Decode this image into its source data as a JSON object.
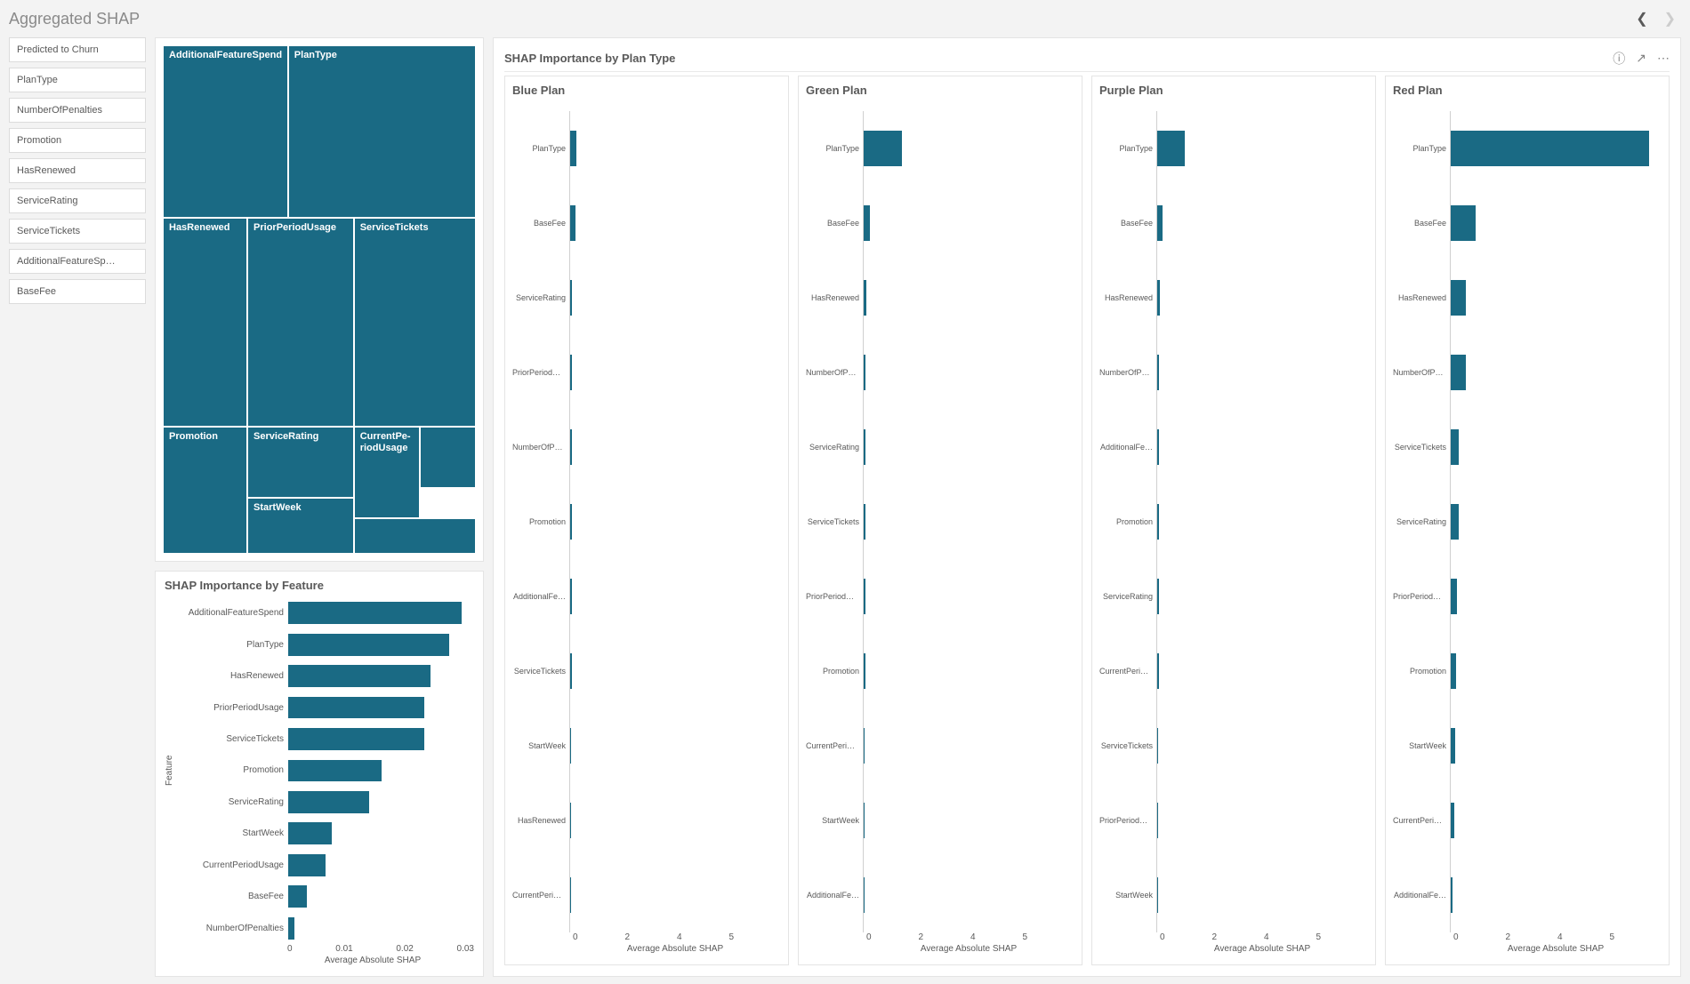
{
  "header": {
    "title": "Aggregated SHAP"
  },
  "filters": [
    "Predicted to Churn",
    "PlanType",
    "NumberOfPenalties",
    "Promotion",
    "HasRenewed",
    "ServiceRating",
    "ServiceTickets",
    "AdditionalFeatureSp…",
    "BaseFee"
  ],
  "treemap": {
    "labels": {
      "AdditionalFeatureSpend": "AdditionalFeatureSpend",
      "PlanType": "PlanType",
      "HasRenewed": "HasRenewed",
      "PriorPeriodUsage": "PriorPeriodUsage",
      "ServiceTickets": "ServiceTickets",
      "Promotion": "Promotion",
      "ServiceRating": "ServiceRating",
      "CurrentPeriodUsage": "CurrentPe-\nriodUsage",
      "StartWeek": "StartWeek"
    }
  },
  "feature_chart": {
    "title": "SHAP Importance by Feature",
    "ylabel": "Feature",
    "xlabel": "Average Absolute SHAP"
  },
  "right_panel": {
    "title": "SHAP Importance by Plan Type",
    "xlabel": "Average Absolute SHAP",
    "plan_titles": [
      "Blue Plan",
      "Green Plan",
      "Purple Plan",
      "Red Plan"
    ]
  },
  "chart_data": {
    "treemap": {
      "type": "treemap",
      "items": [
        {
          "name": "AdditionalFeatureSpend",
          "value": 0.028
        },
        {
          "name": "PlanType",
          "value": 0.026
        },
        {
          "name": "HasRenewed",
          "value": 0.023
        },
        {
          "name": "PriorPeriodUsage",
          "value": 0.022
        },
        {
          "name": "ServiceTickets",
          "value": 0.022
        },
        {
          "name": "Promotion",
          "value": 0.015
        },
        {
          "name": "ServiceRating",
          "value": 0.013
        },
        {
          "name": "StartWeek",
          "value": 0.007
        },
        {
          "name": "CurrentPeriodUsage",
          "value": 0.006
        },
        {
          "name": "BaseFee",
          "value": 0.003
        },
        {
          "name": "NumberOfPenalties",
          "value": 0.001
        }
      ]
    },
    "feature_bar": {
      "type": "bar",
      "orientation": "horizontal",
      "xlabel": "Average Absolute SHAP",
      "ylabel": "Feature",
      "xlim": [
        0,
        0.03
      ],
      "ticks": [
        0,
        0.01,
        0.02,
        0.03
      ],
      "categories": [
        "AdditionalFeatureSpend",
        "PlanType",
        "HasRenewed",
        "PriorPeriodUsage",
        "ServiceTickets",
        "Promotion",
        "ServiceRating",
        "StartWeek",
        "CurrentPeriodUsage",
        "BaseFee",
        "NumberOfPenalties"
      ],
      "values": [
        0.028,
        0.026,
        0.023,
        0.022,
        0.022,
        0.015,
        0.013,
        0.007,
        0.006,
        0.003,
        0.001
      ]
    },
    "plan_bars": {
      "type": "bar",
      "orientation": "horizontal",
      "xlabel": "Average Absolute SHAP",
      "xlim": [
        0,
        5
      ],
      "ticks": [
        0,
        2,
        4,
        5
      ],
      "series": [
        {
          "name": "Blue Plan",
          "categories": [
            "PlanType",
            "BaseFee",
            "ServiceRating",
            "PriorPeriodU…",
            "NumberOfPe…",
            "Promotion",
            "AdditionalFe…",
            "ServiceTickets",
            "StartWeek",
            "HasRenewed",
            "CurrentPerio…"
          ],
          "values": [
            0.15,
            0.12,
            0.05,
            0.05,
            0.05,
            0.04,
            0.04,
            0.04,
            0.03,
            0.03,
            0.02
          ]
        },
        {
          "name": "Green Plan",
          "categories": [
            "PlanType",
            "BaseFee",
            "HasRenewed",
            "NumberOfPe…",
            "ServiceRating",
            "ServiceTickets",
            "PriorPeriodU…",
            "Promotion",
            "CurrentPerio…",
            "StartWeek",
            "AdditionalFe…"
          ],
          "values": [
            0.9,
            0.15,
            0.06,
            0.05,
            0.05,
            0.04,
            0.04,
            0.04,
            0.03,
            0.03,
            0.02
          ]
        },
        {
          "name": "Purple Plan",
          "categories": [
            "PlanType",
            "BaseFee",
            "HasRenewed",
            "NumberOfPe…",
            "AdditionalFe…",
            "Promotion",
            "ServiceRating",
            "CurrentPerio…",
            "ServiceTickets",
            "PriorPeriodU…",
            "StartWeek"
          ],
          "values": [
            0.65,
            0.12,
            0.06,
            0.05,
            0.05,
            0.04,
            0.04,
            0.04,
            0.03,
            0.03,
            0.02
          ]
        },
        {
          "name": "Red Plan",
          "categories": [
            "PlanType",
            "BaseFee",
            "HasRenewed",
            "NumberOfPe…",
            "ServiceTickets",
            "ServiceRating",
            "PriorPeriodU…",
            "Promotion",
            "StartWeek",
            "CurrentPerio…",
            "AdditionalFe…"
          ],
          "values": [
            4.7,
            0.6,
            0.35,
            0.35,
            0.2,
            0.18,
            0.15,
            0.12,
            0.1,
            0.08,
            0.05
          ]
        }
      ]
    }
  }
}
